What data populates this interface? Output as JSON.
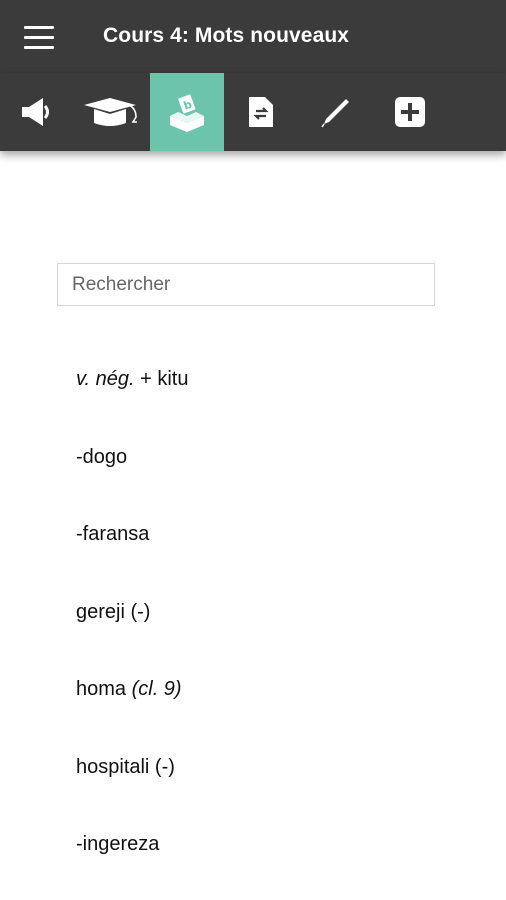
{
  "header": {
    "title": "Cours 4: Mots nouveaux",
    "menu_icon": "hamburger-menu-icon"
  },
  "toolbar": {
    "active_color": "#6cc5ab",
    "bar_color": "#3b3b3b",
    "items": [
      {
        "icon": "megaphone-icon",
        "active": false
      },
      {
        "icon": "graduation-cap-icon",
        "active": false
      },
      {
        "icon": "vocabulary-box-icon",
        "active": true
      },
      {
        "icon": "document-translate-icon",
        "active": false
      },
      {
        "icon": "pencil-icon",
        "active": false
      },
      {
        "icon": "plus-icon",
        "active": false
      }
    ]
  },
  "search": {
    "placeholder": "Rechercher"
  },
  "words": [
    {
      "prefix": "v. nég.",
      "text": " + kitu",
      "suffix": ""
    },
    {
      "prefix": "",
      "text": "-dogo",
      "suffix": ""
    },
    {
      "prefix": "",
      "text": "-faransa",
      "suffix": ""
    },
    {
      "prefix": "",
      "text": "gereji (-)",
      "suffix": ""
    },
    {
      "prefix": "",
      "text": "homa ",
      "suffix": "(cl. 9)"
    },
    {
      "prefix": "",
      "text": "hospitali (-)",
      "suffix": ""
    },
    {
      "prefix": "",
      "text": "-ingereza",
      "suffix": ""
    }
  ]
}
